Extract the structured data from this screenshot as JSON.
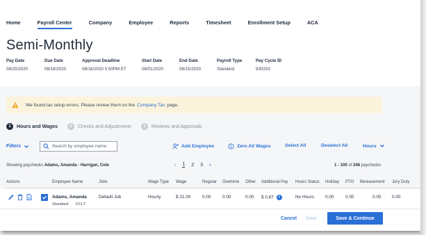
{
  "nav": {
    "items": [
      "Home",
      "Payroll Center",
      "Company",
      "Employee",
      "Reports",
      "Timesheet",
      "Enrollment Setup",
      "ACA"
    ],
    "active": "Payroll Center"
  },
  "page": {
    "title": "Semi-Monthly"
  },
  "meta": [
    {
      "label": "Pay Date",
      "value": "08/20/2020"
    },
    {
      "label": "Due Date",
      "value": "08/18/2020"
    },
    {
      "label": "Approval Deadline",
      "value": "08/18/2020 5:00PM ET"
    },
    {
      "label": "Start Date",
      "value": "08/01/2020"
    },
    {
      "label": "End Date",
      "value": "08/15/2020"
    },
    {
      "label": "Payroll Type",
      "value": "Standard"
    },
    {
      "label": "Pay Cycle ID",
      "value": "830203"
    }
  ],
  "alert": {
    "text_before": "We found tax setup errors. Please review them on the",
    "link": "Company Tax",
    "text_after": "page."
  },
  "steps": [
    {
      "num": "1",
      "label": "Hours and Wages"
    },
    {
      "num": "2",
      "label": "Checks and Adjustments"
    },
    {
      "num": "3",
      "label": "Reviews and Approvals"
    }
  ],
  "toolbar": {
    "filters": "Filters",
    "search_placeholder": "Search by employee name",
    "add_employee": "Add Employee",
    "zero_all": "Zero All Wages",
    "select_all": "Select All",
    "deselect_all": "Deselect All",
    "hours": "Hours"
  },
  "listing": {
    "showing_prefix": "Showing paychecks",
    "showing_range": "Adams, Amanda - Harrigan, Cole",
    "pages": [
      "1",
      "2",
      "3"
    ],
    "count_range": "1 - 100",
    "count_of": "of",
    "count_total": "246",
    "count_suffix": "paychecks"
  },
  "table": {
    "headers": [
      "Actions",
      "Employee Name",
      "Jobs",
      "Wage Type",
      "Wage",
      "Regular",
      "Overtime",
      "Other",
      "Additional Pay",
      "Hours Status",
      "Holiday",
      "PTO",
      "Bereavement",
      "Jury Duty"
    ],
    "row": {
      "name": "Adams, Amanda",
      "sub1": "Standard",
      "sub2": "FCLT",
      "job": "Default Job",
      "wage_type": "Hourly",
      "wage": "$ 21.00",
      "regular": "0.00",
      "overtime": "0.00",
      "other": "0.00",
      "additional": "$ 0.87",
      "hours_status": "No Hours",
      "holiday": "0.00",
      "pto": "0.00",
      "bereavement": "0.00",
      "jury": "0.00"
    }
  },
  "footer": {
    "cancel": "Cancel",
    "save": "Save",
    "continue": "Save & Continue"
  },
  "colors": {
    "accent": "#2a6fd6",
    "alert_bg": "#fbf3dc",
    "alert_icon": "#f0a92c",
    "text": "#1f2a3a"
  }
}
